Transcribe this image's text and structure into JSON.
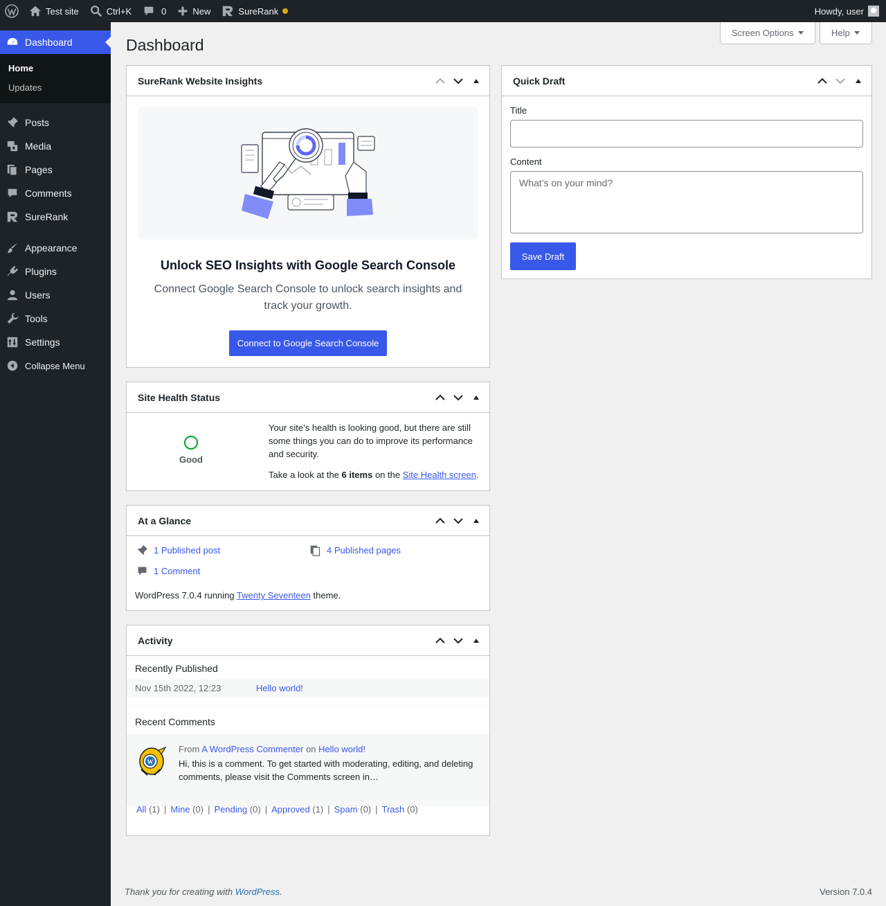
{
  "admin_bar": {
    "site_name": "Test site",
    "search_shortcut": "Ctrl+K",
    "comments_count": "0",
    "new_label": "New",
    "plugin_label": "SureRank",
    "howdy": "Howdy, user"
  },
  "sidebar": {
    "dashboard": "Dashboard",
    "sub_home": "Home",
    "sub_updates": "Updates",
    "items": [
      {
        "label": "Posts",
        "icon": "pin-icon"
      },
      {
        "label": "Media",
        "icon": "media-icon"
      },
      {
        "label": "Pages",
        "icon": "pages-icon"
      },
      {
        "label": "Comments",
        "icon": "comment-icon"
      },
      {
        "label": "SureRank",
        "icon": "surerank-icon"
      },
      {
        "label": "Appearance",
        "icon": "brush-icon"
      },
      {
        "label": "Plugins",
        "icon": "plugin-icon"
      },
      {
        "label": "Users",
        "icon": "user-icon"
      },
      {
        "label": "Tools",
        "icon": "wrench-icon"
      },
      {
        "label": "Settings",
        "icon": "settings-icon"
      }
    ],
    "collapse": "Collapse Menu"
  },
  "header": {
    "title": "Dashboard",
    "screen_options": "Screen Options",
    "help": "Help"
  },
  "insights": {
    "title": "SureRank Website Insights",
    "heading": "Unlock SEO Insights with Google Search Console",
    "subtext": "Connect Google Search Console to unlock search insights and track your growth.",
    "button": "Connect to Google Search Console"
  },
  "site_health": {
    "title": "Site Health Status",
    "status": "Good",
    "message": "Your site’s health is looking good, but there are still some things you can do to improve its performance and security.",
    "take_look_pre": "Take a look at the ",
    "items_count": "6 items",
    "take_look_mid": " on the ",
    "link": "Site Health screen",
    "take_look_post": "."
  },
  "glance": {
    "title": "At a Glance",
    "posts": "1 Published post",
    "pages": "4 Published pages",
    "comments": "1 Comment",
    "footer_pre": "WordPress 7.0.4 running ",
    "theme": "Twenty Seventeen",
    "footer_post": " theme."
  },
  "activity": {
    "title": "Activity",
    "recently_published": "Recently Published",
    "post_date": "Nov 15th 2022, 12:23",
    "post_title": "Hello world!",
    "recent_comments": "Recent Comments",
    "comment_from": "From ",
    "comment_author": "A WordPress Commenter",
    "comment_on": " on ",
    "comment_post": "Hello world!",
    "comment_text": "Hi, this is a comment. To get started with moderating, editing, and deleting comments, please visit the Comments screen in…",
    "filters": [
      {
        "label": "All",
        "count": "(1)"
      },
      {
        "label": "Mine",
        "count": "(0)"
      },
      {
        "label": "Pending",
        "count": "(0)"
      },
      {
        "label": "Approved",
        "count": "(1)"
      },
      {
        "label": "Spam",
        "count": "(0)"
      },
      {
        "label": "Trash",
        "count": "(0)"
      }
    ]
  },
  "quick_draft": {
    "title": "Quick Draft",
    "title_label": "Title",
    "title_value": "",
    "content_label": "Content",
    "content_placeholder": "What’s on your mind?",
    "save": "Save Draft"
  },
  "footer": {
    "thanks_pre": "Thank you for creating with ",
    "thanks_link": "WordPress",
    "thanks_post": ".",
    "version": "Version 7.0.4"
  },
  "colors": {
    "accent": "#3858e9",
    "admin_dark": "#1d2327",
    "health_good": "#00a32a"
  }
}
